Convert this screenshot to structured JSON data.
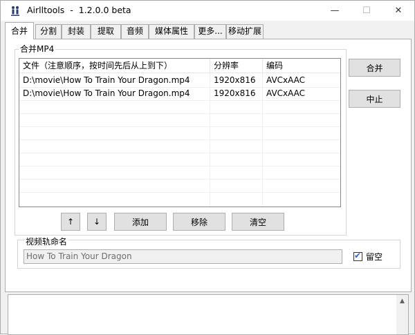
{
  "window": {
    "title": "Airlltools  -  1.2.0.0 beta",
    "minimize_glyph": "—",
    "maximize_glyph": "☐",
    "close_glyph": "✕"
  },
  "tabs": [
    {
      "label": "合并",
      "active": true
    },
    {
      "label": "分割",
      "active": false
    },
    {
      "label": "封装",
      "active": false
    },
    {
      "label": "提取",
      "active": false
    },
    {
      "label": "音频",
      "active": false
    },
    {
      "label": "媒体属性",
      "active": false
    },
    {
      "label": "更多...",
      "active": false
    },
    {
      "label": "移动扩展",
      "active": false
    }
  ],
  "merge_group": {
    "title": "合并MP4",
    "columns": [
      "文件（注意顺序，按时间先后从上到下）",
      "分辨率",
      "编码"
    ],
    "rows": [
      {
        "file": "D:\\movie\\How To Train Your Dragon.mp4",
        "resolution": "1920x816",
        "codec": "AVCxAAC"
      },
      {
        "file": "D:\\movie\\How To Train Your Dragon.mp4",
        "resolution": "1920x816",
        "codec": "AVCxAAC"
      }
    ]
  },
  "actions": {
    "merge": "合并",
    "stop": "中止",
    "move_up": "↑",
    "move_down": "↓",
    "add": "添加",
    "remove": "移除",
    "clear": "清空"
  },
  "rename": {
    "title": "视频轨命名",
    "value": "How To Train Your Dragon",
    "keep_empty_label": "留空",
    "keep_empty_checked": true
  },
  "colors": {
    "accent": "#2c63c7",
    "window_bg": "#f0f0f0",
    "panel_bg": "#ffffff",
    "border": "#adadad"
  }
}
